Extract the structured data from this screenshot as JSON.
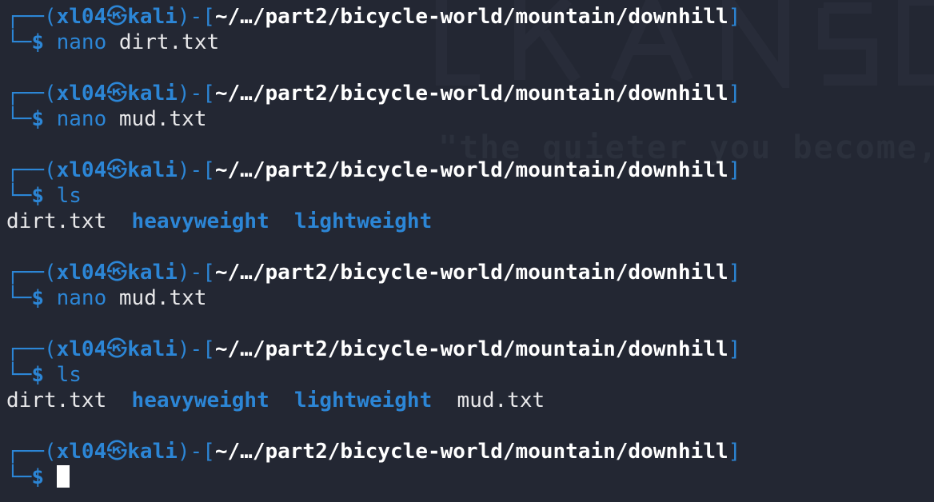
{
  "watermark": {
    "quote": "\"the quieter you become,"
  },
  "prompt": {
    "frame_open": "┌──(",
    "user": "xl04",
    "skull": "㉿",
    "host": "kali",
    "mid": ")-[",
    "path": "~/…/part2/bicycle-world/mountain/downhill",
    "close": "]",
    "corner": "└─",
    "dollar": "$"
  },
  "commands": [
    {
      "cmd": "nano",
      "arg": "dirt.txt"
    },
    {
      "cmd": "nano",
      "arg": "mud.txt"
    },
    {
      "cmd": "ls",
      "arg": ""
    },
    {
      "cmd": "nano",
      "arg": "mud.txt"
    },
    {
      "cmd": "ls",
      "arg": ""
    }
  ],
  "ls_output_1": {
    "file1": "dirt.txt",
    "dir1": "heavyweight",
    "dir2": "lightweight"
  },
  "ls_output_2": {
    "file1": "dirt.txt",
    "dir1": "heavyweight",
    "dir2": "lightweight",
    "file2": "mud.txt"
  }
}
